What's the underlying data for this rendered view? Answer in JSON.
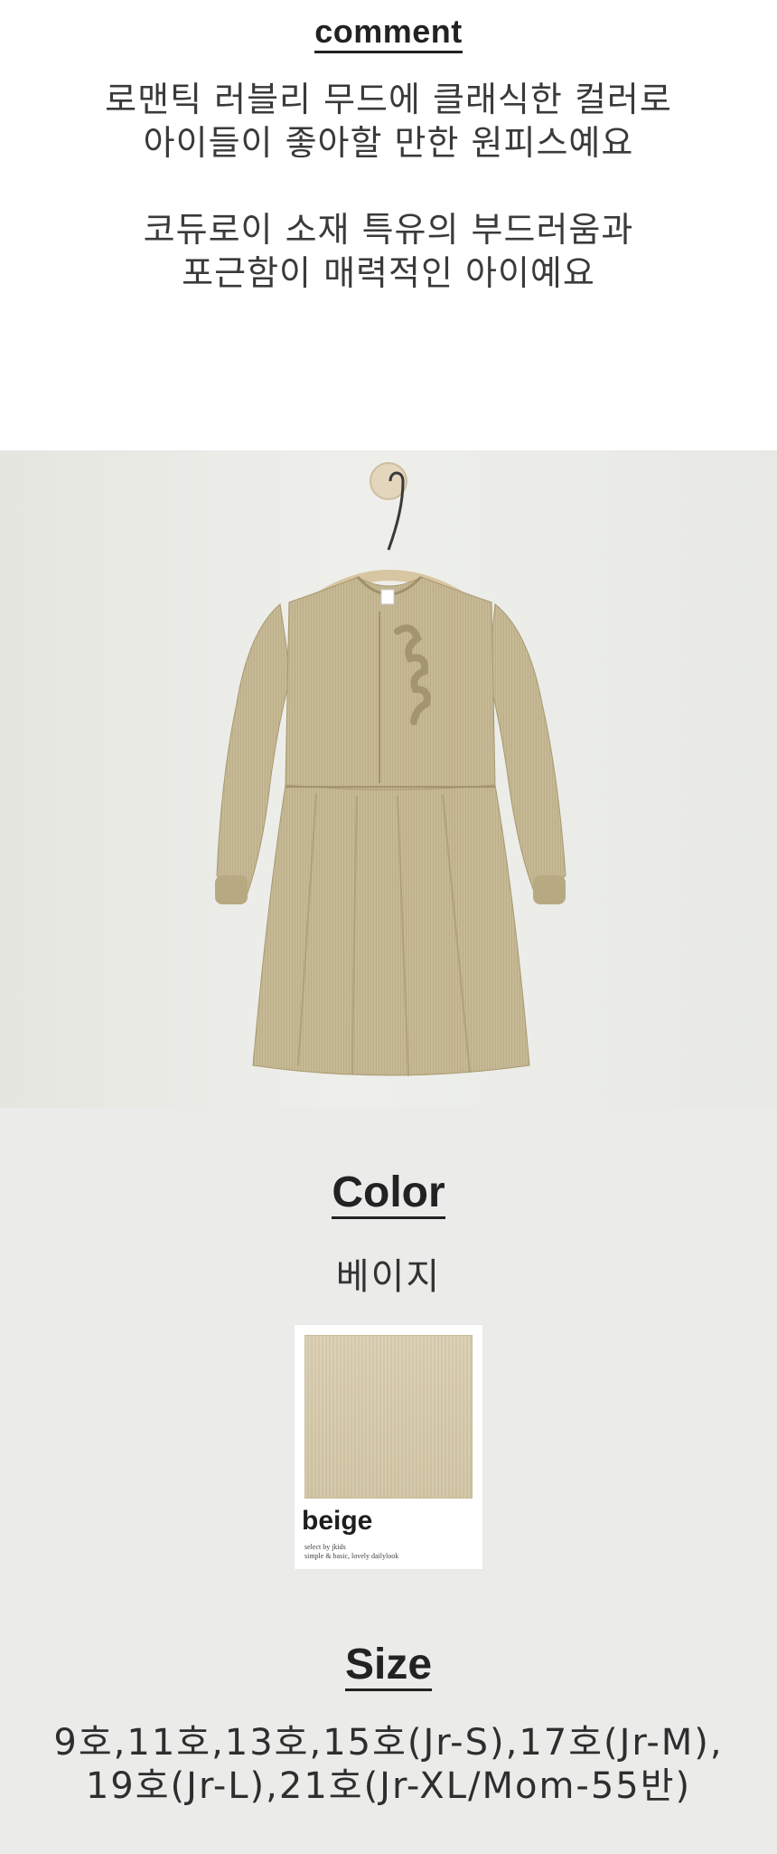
{
  "comment": {
    "title": "comment",
    "paragraph1": [
      "로맨틱 러블리 무드에 클래식한 컬러로",
      "아이들이 좋아할 만한 원피스예요"
    ],
    "paragraph2": [
      "코듀로이 소재 특유의 부드러움과",
      "포근함이 매력적인 아이예요"
    ]
  },
  "color": {
    "title": "Color",
    "name": "베이지",
    "swatch": {
      "label": "beige",
      "sub1": "select by jkids",
      "sub2": "simple & basic, lovely dailylook",
      "hex": "#d5caad"
    }
  },
  "size": {
    "title": "Size",
    "line1": "9호,11호,13호,15호(Jr-S),17호(Jr-M),",
    "line2": "19호(Jr-L),21호(Jr-XL/Mom-55반)"
  },
  "colors": {
    "dress": "#c4b68f",
    "background_top": "#ffffff",
    "background_info": "#ebebea"
  }
}
